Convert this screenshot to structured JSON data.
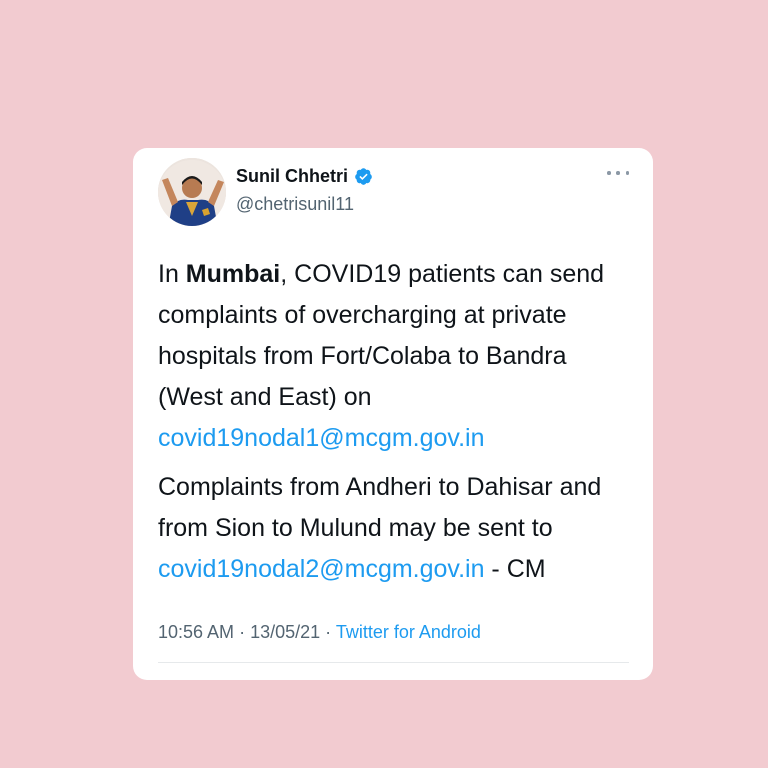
{
  "tweet": {
    "author_name": "Sunil Chhetri",
    "author_handle": "@chetrisunil11",
    "verified": true,
    "paragraph1": {
      "before_bold": "In ",
      "bold": "Mumbai",
      "after_bold": ", COVID19 patients can send complaints of overcharging at private hospitals from Fort/Colaba to Bandra (West and East) on ",
      "email": "covid19nodal1@mcgm.gov.in"
    },
    "paragraph2": {
      "text": "Complaints from Andheri to Dahisar and from Sion to Mulund may be sent to ",
      "email": "covid19nodal2@mcgm.gov.in",
      "suffix": " - CM"
    },
    "time": "10:56 AM",
    "separator": " · ",
    "date": "13/05/21",
    "source": "Twitter for Android"
  },
  "colors": {
    "background": "#f2cbd0",
    "card": "#ffffff",
    "link": "#1d9bf0",
    "secondary_text": "#536471",
    "verified_badge": "#1d9bf0"
  },
  "icons": {
    "verified": "verified-badge-icon",
    "more": "more-options-icon"
  }
}
